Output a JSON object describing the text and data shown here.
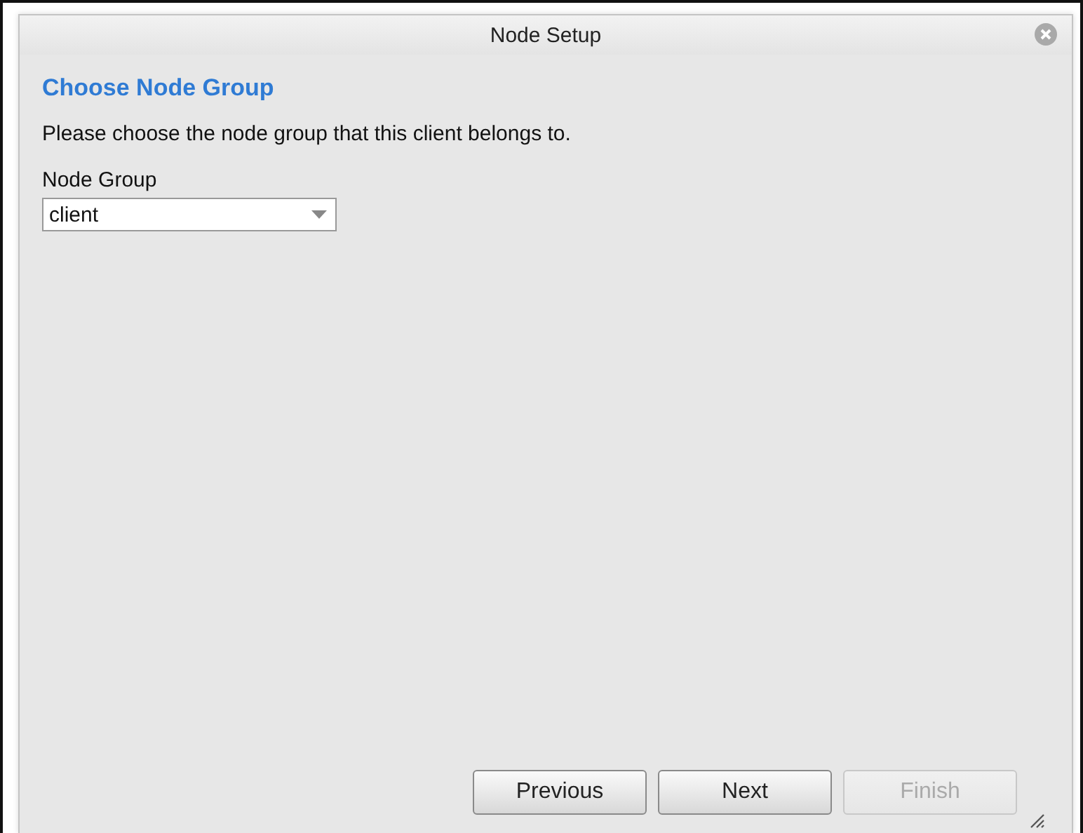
{
  "dialog": {
    "title": "Node Setup",
    "heading": "Choose Node Group",
    "instructions": "Please choose the node group that this client belongs to.",
    "field": {
      "label": "Node Group",
      "value": "client"
    },
    "buttons": [
      {
        "label": "Previous",
        "disabled": false
      },
      {
        "label": "Next",
        "disabled": false
      },
      {
        "label": "Finish",
        "disabled": true
      }
    ]
  }
}
